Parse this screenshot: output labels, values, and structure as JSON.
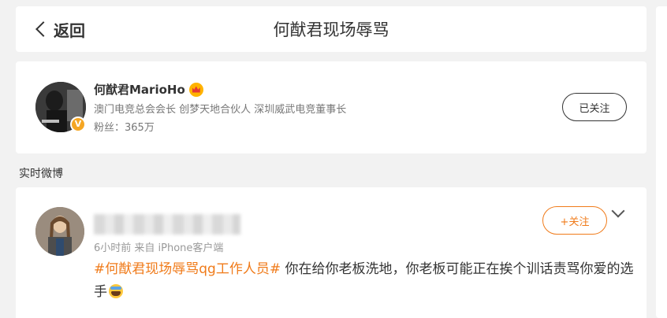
{
  "header": {
    "back_label": "返回",
    "title": "何猷君现场辱骂"
  },
  "profile": {
    "name": "何猷君MarioHo",
    "description": "澳门电竞总会会长 创梦天地合伙人 深圳威武电竞董事长",
    "fans": "粉丝：365万",
    "follow_state": "已关注",
    "verified_mark": "V"
  },
  "section": {
    "label": "实时微博"
  },
  "post": {
    "meta": "6小时前 来自 iPhone客户端",
    "follow_label": "+关注",
    "hashtag": "#何猷君现场辱骂qg工作人员#",
    "text": " 你在给你老板洗地，你老板可能正在挨个训话责骂你爱的选手"
  },
  "colors": {
    "accent": "#f07b1a",
    "verified": "#f5a623",
    "background": "#f2f2f2"
  },
  "icons": {
    "back": "chevron-left-icon",
    "crown": "crown-icon",
    "more": "chevron-down-icon",
    "emoji": "scream-emoji-icon"
  }
}
